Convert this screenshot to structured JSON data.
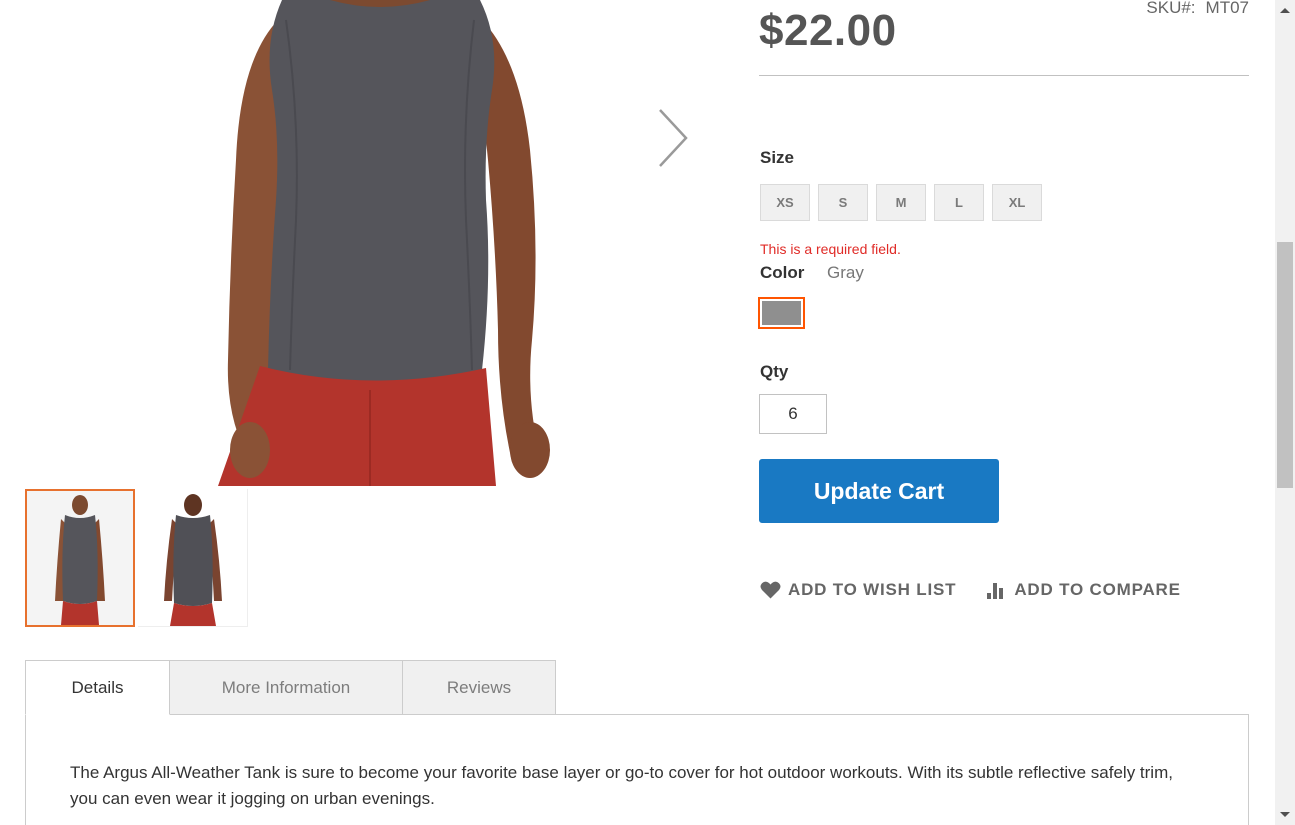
{
  "product": {
    "price": "$22.00",
    "sku_label": "SKU#:",
    "sku_value": "MT07"
  },
  "gallery": {
    "main_image_icon": "model-front-view-image",
    "next_icon": "chevron-right-icon",
    "thumbnails": [
      {
        "icon": "thumbnail-front-image",
        "active": true
      },
      {
        "icon": "thumbnail-back-image",
        "active": false
      }
    ]
  },
  "options": {
    "size_label": "Size",
    "sizes": [
      "XS",
      "S",
      "M",
      "L",
      "XL"
    ],
    "size_error": "This is a required field.",
    "color_label": "Color",
    "color_value": "Gray",
    "color_swatch": "#8f8f8f",
    "qty_label": "Qty",
    "qty_value": "6"
  },
  "actions": {
    "update_cart": "Update Cart",
    "wish_list": "ADD TO WISH LIST",
    "compare": "ADD TO COMPARE"
  },
  "tabs": [
    {
      "label": "Details",
      "active": true
    },
    {
      "label": "More Information",
      "active": false
    },
    {
      "label": "Reviews",
      "active": false
    }
  ],
  "details": {
    "text": "The Argus All-Weather Tank is sure to become your favorite base layer or go-to cover for hot outdoor workouts. With its subtle reflective safely trim, you can even wear it jogging on urban evenings."
  },
  "colors": {
    "accent_blue": "#1979c3",
    "active_border": "#e7712e",
    "error_red": "#e02b27",
    "shirt_gray": "#55555b",
    "shorts_red": "#b3342c"
  }
}
